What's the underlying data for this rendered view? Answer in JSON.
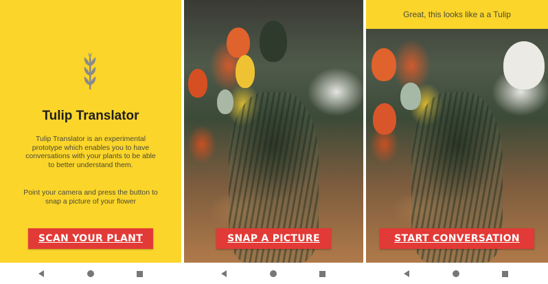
{
  "screen1": {
    "title": "Tulip Translator",
    "description": "Tulip Translator is an experimental prototype which enables you to have conversations with your plants to be able to better understand them.",
    "hint": "Point your camera and press the button to snap a picture of your flower",
    "button_label": "SCAN YOUR PLANT",
    "logo_icon": "tulip-logo-icon"
  },
  "screen2": {
    "button_label": "SNAP A PICTURE"
  },
  "screen3": {
    "result_text": "Great, this looks like a a Tulip",
    "button_label": "START CONVERSATION"
  },
  "colors": {
    "brand_yellow": "#fbd52a",
    "button_red": "#e23a36",
    "text_dark": "#1e1e1e",
    "text_muted": "#4a4a3a"
  },
  "navbar_icons": [
    "back-icon",
    "home-icon",
    "recents-icon"
  ]
}
